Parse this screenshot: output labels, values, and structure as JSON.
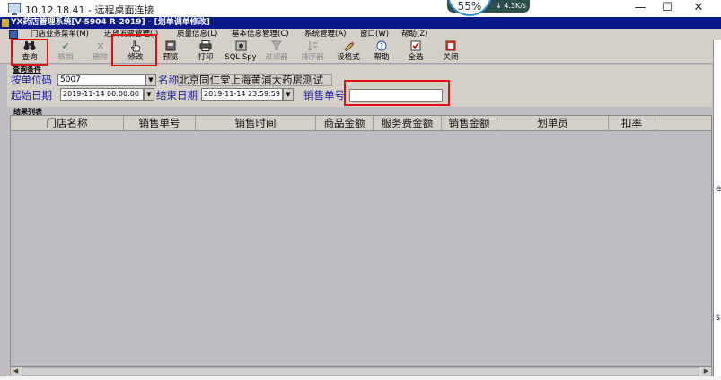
{
  "rdp": {
    "title": "10.12.18.41 - 远程桌面连接",
    "minimize": "—",
    "maximize": "☐",
    "close": "✕"
  },
  "network": {
    "percent": "55%",
    "speed": "↓ 4.3K/s"
  },
  "app": {
    "title": "YX药店管理系统[V-5904 R-2019] - [划单调单修改]"
  },
  "menu": [
    "门店业务菜单(M)",
    "进货发票管理(J)",
    "质量信息(L)",
    "基本信息管理(C)",
    "系统管理(A)",
    "窗口(W)",
    "帮助(Z)"
  ],
  "toolbar": {
    "query": "查询",
    "verify": "核销",
    "delete": "删除",
    "modify": "修改",
    "preview": "预览",
    "print": "打印",
    "sqlspy": "SQL Spy",
    "filter": "过滤器",
    "sorter": "排序器",
    "format": "设格式",
    "help": "帮助",
    "selectall": "全选",
    "close": "关闭"
  },
  "query": {
    "group_caption": "查询条件",
    "store_code_label": "按单位码",
    "store_code_value": "5007",
    "name_label": "名称",
    "name_value": "北京同仁堂上海黄浦大药房测试",
    "start_label": "起始日期",
    "start_value": "2019-11-14 00:00:00",
    "end_label": "结束日期",
    "end_value": "2019-11-14 23:59:59",
    "sale_no_label": "销售单号",
    "sale_no_value": ""
  },
  "results": {
    "caption": "结果列表",
    "columns": [
      "门店名称",
      "销售单号",
      "销售时间",
      "商品金额",
      "服务费金额",
      "销售金额",
      "划单员",
      "扣率"
    ]
  },
  "edge": {
    "char1": "e",
    "char2": "s"
  }
}
